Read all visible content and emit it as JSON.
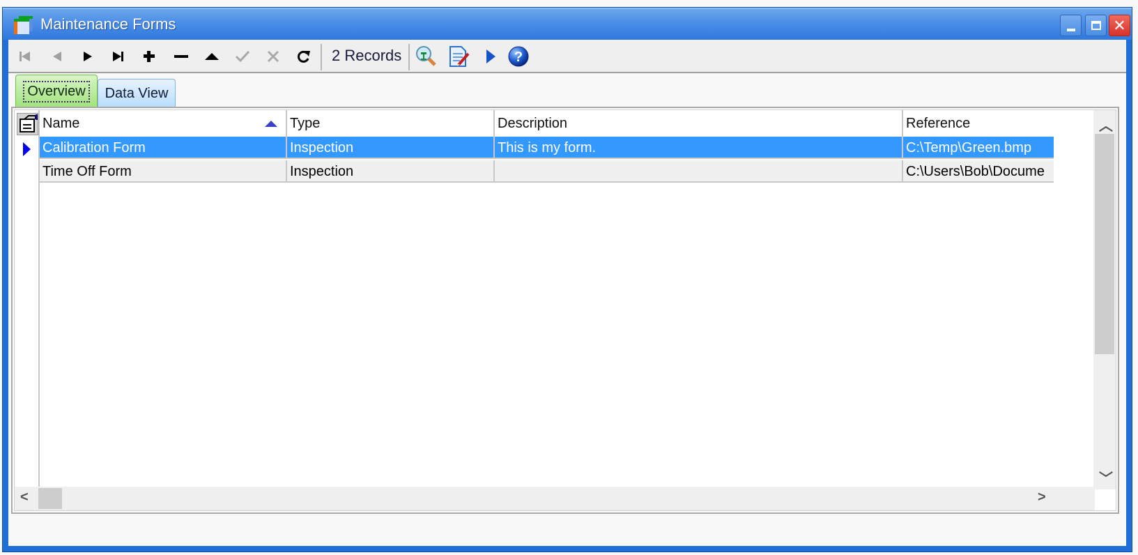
{
  "window": {
    "title": "Maintenance Forms",
    "icon": "app-form-icon",
    "controls": [
      "minimize",
      "maximize",
      "close"
    ]
  },
  "toolbar": {
    "buttons": [
      {
        "name": "first-record",
        "icon": "first-icon",
        "glyph": "⏮",
        "enabled": false
      },
      {
        "name": "previous-record",
        "icon": "previous-icon",
        "glyph": "◀",
        "enabled": false
      },
      {
        "name": "next-record",
        "icon": "next-icon",
        "glyph": "▶",
        "enabled": true
      },
      {
        "name": "last-record",
        "icon": "last-icon",
        "glyph": "⏭",
        "enabled": true
      },
      {
        "name": "add-record",
        "icon": "plus-icon",
        "glyph": "✚",
        "enabled": true
      },
      {
        "name": "delete-record",
        "icon": "minus-icon",
        "glyph": "━",
        "enabled": true
      },
      {
        "name": "edit-record",
        "icon": "up-triangle-icon",
        "glyph": "▲",
        "enabled": true
      },
      {
        "name": "post-edit",
        "icon": "check-icon",
        "glyph": "✔",
        "enabled": false
      },
      {
        "name": "cancel-edit",
        "icon": "x-icon",
        "glyph": "✕",
        "enabled": false
      },
      {
        "name": "refresh",
        "icon": "refresh-icon",
        "glyph": "↻",
        "enabled": true
      }
    ],
    "record_count": "2 Records",
    "extra_buttons": [
      {
        "name": "find",
        "icon": "magnifier-icon"
      },
      {
        "name": "edit-form",
        "icon": "document-edit-icon"
      },
      {
        "name": "run",
        "icon": "play-icon"
      },
      {
        "name": "help",
        "icon": "help-icon",
        "glyph": "?"
      }
    ]
  },
  "tabs": [
    {
      "label": "Overview",
      "active": true
    },
    {
      "label": "Data View",
      "active": false
    }
  ],
  "grid": {
    "columns": [
      {
        "label": "Name",
        "sorted": "ascending"
      },
      {
        "label": "Type"
      },
      {
        "label": "Description"
      },
      {
        "label": "Reference"
      }
    ],
    "rows": [
      {
        "name": "Calibration Form",
        "type": "Inspection",
        "description": "This is my form.",
        "reference": "C:\\Temp\\Green.bmp",
        "selected": true
      },
      {
        "name": "Time Off Form",
        "type": "Inspection",
        "description": "",
        "reference": "C:\\Users\\Bob\\Docume",
        "selected": false
      }
    ]
  },
  "colors": {
    "title_bar": "#2f79dd",
    "selection": "#3399ff",
    "active_tab": "#9fe27a",
    "inactive_tab": "#b6dcfa"
  }
}
